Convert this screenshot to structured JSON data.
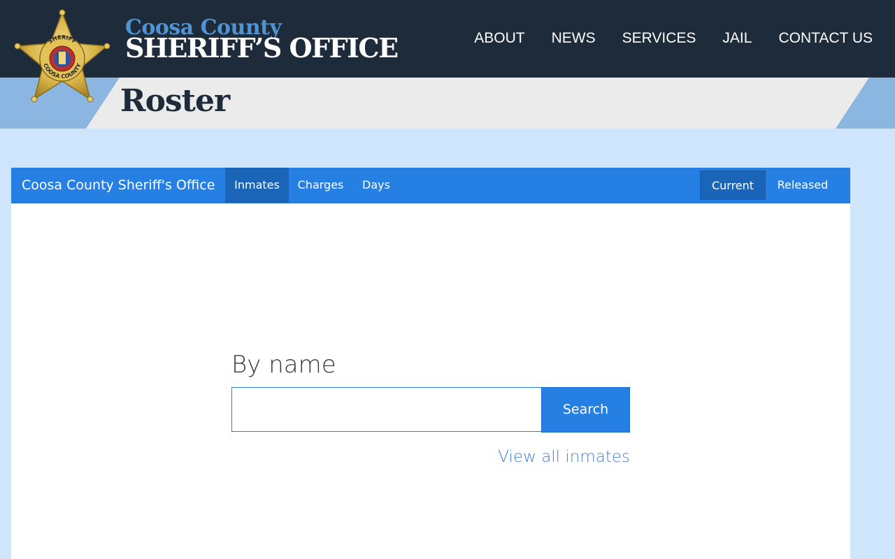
{
  "header": {
    "brand_line1": "Coosa County",
    "brand_line2": "SHERIFF’S OFFICE",
    "badge": {
      "icon": "sheriff-star-badge-icon",
      "top_text": "SHERIFF",
      "bottom_text": "COOSA COUNTY",
      "color": "#d9b54a"
    },
    "nav": [
      {
        "label": "ABOUT"
      },
      {
        "label": "NEWS"
      },
      {
        "label": "SERVICES"
      },
      {
        "label": "JAIL"
      },
      {
        "label": "CONTACT US"
      }
    ]
  },
  "banner": {
    "title": "Roster"
  },
  "roster": {
    "brand": "Coosa County Sheriff's Office",
    "tabs": [
      {
        "label": "Inmates",
        "active": true
      },
      {
        "label": "Charges",
        "active": false
      },
      {
        "label": "Days",
        "active": false
      }
    ],
    "filters": [
      {
        "label": "Current",
        "active": true
      },
      {
        "label": "Released",
        "active": false
      }
    ],
    "search": {
      "label": "By name",
      "value": "",
      "placeholder": "",
      "button_label": "Search"
    },
    "view_all_label": "View all inmates"
  },
  "colors": {
    "header_bg": "#1e2b3a",
    "brand_accent": "#4f93d2",
    "nav_blue": "#2680e3",
    "nav_active": "#1b65b8",
    "page_bg": "#cfe5fb",
    "link": "#4a7fd0"
  }
}
